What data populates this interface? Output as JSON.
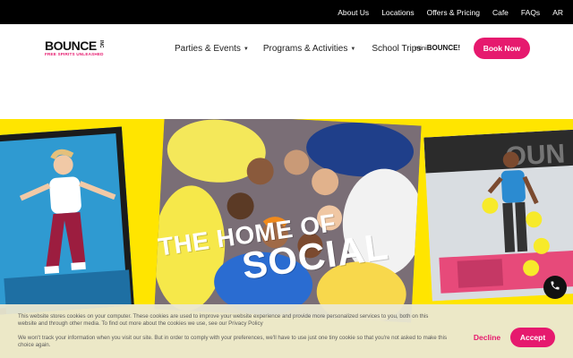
{
  "topbar": {
    "items": [
      "About Us",
      "Locations",
      "Offers & Pricing",
      "Cafe",
      "FAQs",
      "AR"
    ]
  },
  "header": {
    "logo_word": "BOUNCE",
    "logo_inc": "INC",
    "logo_tagline": "FREE SPIRITS UNLEASHED",
    "nav": {
      "parties": "Parties & Events",
      "programs": "Programs & Activities",
      "school": "School Trips"
    },
    "mini_logo_prefix": "mini",
    "mini_logo_word": "BOUNCE!",
    "book_label": "Book Now"
  },
  "hero": {
    "title_line1": "THE HOME OF",
    "title_line2": "SOCIAL"
  },
  "cookie": {
    "text1": "This website stores cookies on your computer. These cookies are used to improve your website experience and provide more personalized services to you, both on this website and through other media. To find out more about the cookies we use, see our Privacy Policy",
    "text2": "We won't track your information when you visit our site. But in order to comply with your preferences, we'll have to use just one tiny cookie so that you're not asked to make this choice again.",
    "decline_label": "Decline",
    "accept_label": "Accept"
  },
  "colors": {
    "brand_pink": "#e6196e",
    "hero_yellow": "#ffe500",
    "topbar_black": "#000000"
  },
  "icons": {
    "chevron": "chevron-down-icon",
    "phone": "phone-icon"
  }
}
